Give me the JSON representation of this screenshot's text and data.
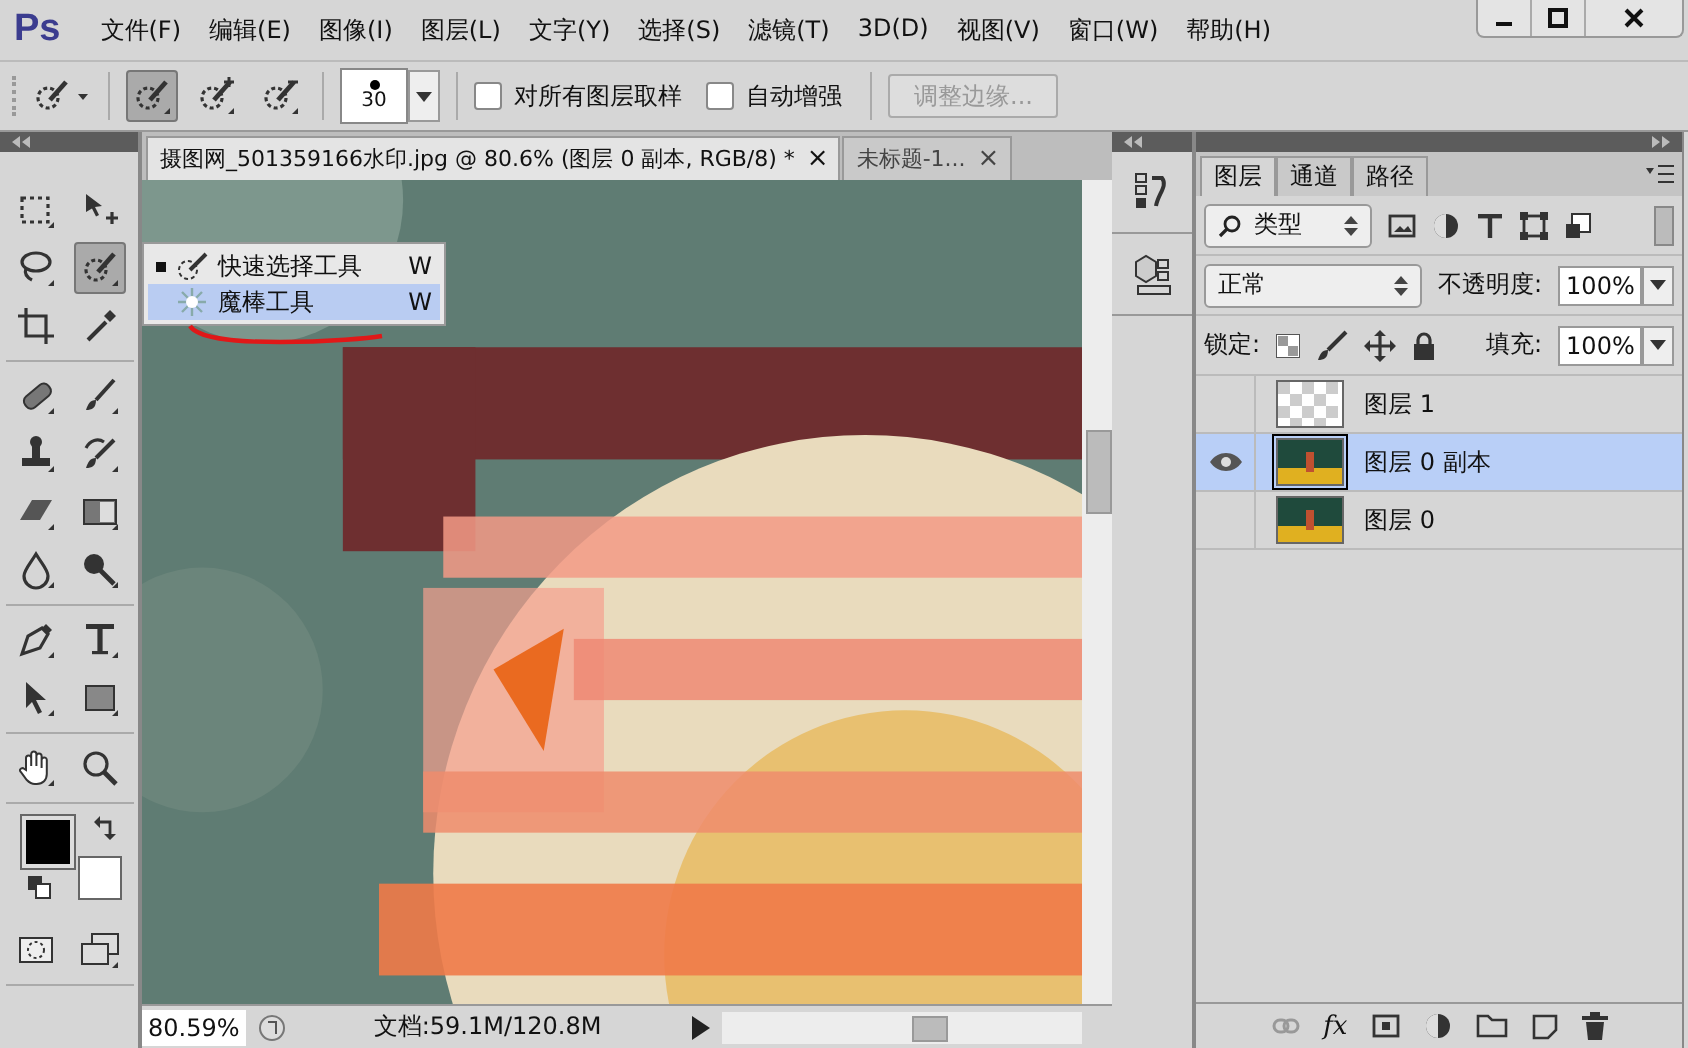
{
  "app_logo": "Ps",
  "menu_bar": [
    "文件(F)",
    "编辑(E)",
    "图像(I)",
    "图层(L)",
    "文字(Y)",
    "选择(S)",
    "滤镜(T)",
    "3D(D)",
    "视图(V)",
    "窗口(W)",
    "帮助(H)"
  ],
  "options_bar": {
    "modes": [
      {
        "kind": "new",
        "selected": true
      },
      {
        "kind": "add",
        "selected": false
      },
      {
        "kind": "subtract",
        "selected": false
      }
    ],
    "brush_size": "30",
    "checkboxes": [
      {
        "label": "对所有图层取样",
        "checked": false
      },
      {
        "label": "自动增强",
        "checked": false
      }
    ],
    "refine_button": {
      "label": "调整边缘...",
      "disabled": true
    }
  },
  "toolbox": {
    "groups": [
      [
        {
          "kind": "marquee",
          "selected": false
        },
        {
          "kind": "move",
          "selected": false
        },
        {
          "kind": "lasso",
          "selected": false
        },
        {
          "kind": "quick-select",
          "selected": true
        },
        {
          "kind": "crop",
          "selected": false
        },
        {
          "kind": "eyedropper",
          "selected": false
        }
      ],
      [
        {
          "kind": "healing",
          "selected": false
        },
        {
          "kind": "brush",
          "selected": false
        },
        {
          "kind": "stamp",
          "selected": false
        },
        {
          "kind": "history-brush",
          "selected": false
        },
        {
          "kind": "eraser",
          "selected": false
        },
        {
          "kind": "gradient",
          "selected": false
        },
        {
          "kind": "blur",
          "selected": false
        },
        {
          "kind": "dodge",
          "selected": false
        }
      ],
      [
        {
          "kind": "pen",
          "selected": false
        },
        {
          "kind": "type",
          "selected": false
        },
        {
          "kind": "path-select",
          "selected": false
        },
        {
          "kind": "shape",
          "selected": false
        }
      ],
      [
        {
          "kind": "hand",
          "selected": false
        },
        {
          "kind": "zoom",
          "selected": false
        }
      ]
    ],
    "color_swatches": [
      {
        "kind": "foreground",
        "color": "#000000"
      },
      {
        "kind": "background",
        "color": "#ffffff"
      }
    ]
  },
  "tool_flyout": [
    {
      "label": "快速选择工具",
      "shortcut": "W",
      "current": true,
      "selected": false
    },
    {
      "label": "魔棒工具",
      "shortcut": "W",
      "current": false,
      "selected": true
    }
  ],
  "document_tabs": [
    {
      "title": "摄图网_501359166水印.jpg @ 80.6% (图层 0 副本, RGB/8) *",
      "close": "×",
      "selected": true
    },
    {
      "title": "未标题-1...",
      "close": "×",
      "selected": false
    }
  ],
  "status_bar": {
    "zoom": "80.59%",
    "doc_info": "文档:59.1M/120.8M"
  },
  "layers_panel": {
    "tabs": [
      {
        "label": "图层",
        "selected": true
      },
      {
        "label": "通道",
        "selected": false
      },
      {
        "label": "路径",
        "selected": false
      }
    ],
    "filter": "类型",
    "blend_mode": "正常",
    "opacity_label": "不透明度:",
    "opacity": "100%",
    "lock_label": "锁定:",
    "fill_label": "填充:",
    "fill": "100%",
    "layers": [
      {
        "name": "图层 1",
        "visible": false,
        "selected": false,
        "kind": "transparent"
      },
      {
        "name": "图层 0 副本",
        "visible": true,
        "selected": true,
        "kind": "photo"
      },
      {
        "name": "图层 0",
        "visible": false,
        "selected": false,
        "kind": "photo"
      }
    ],
    "fx_button": "fx"
  }
}
